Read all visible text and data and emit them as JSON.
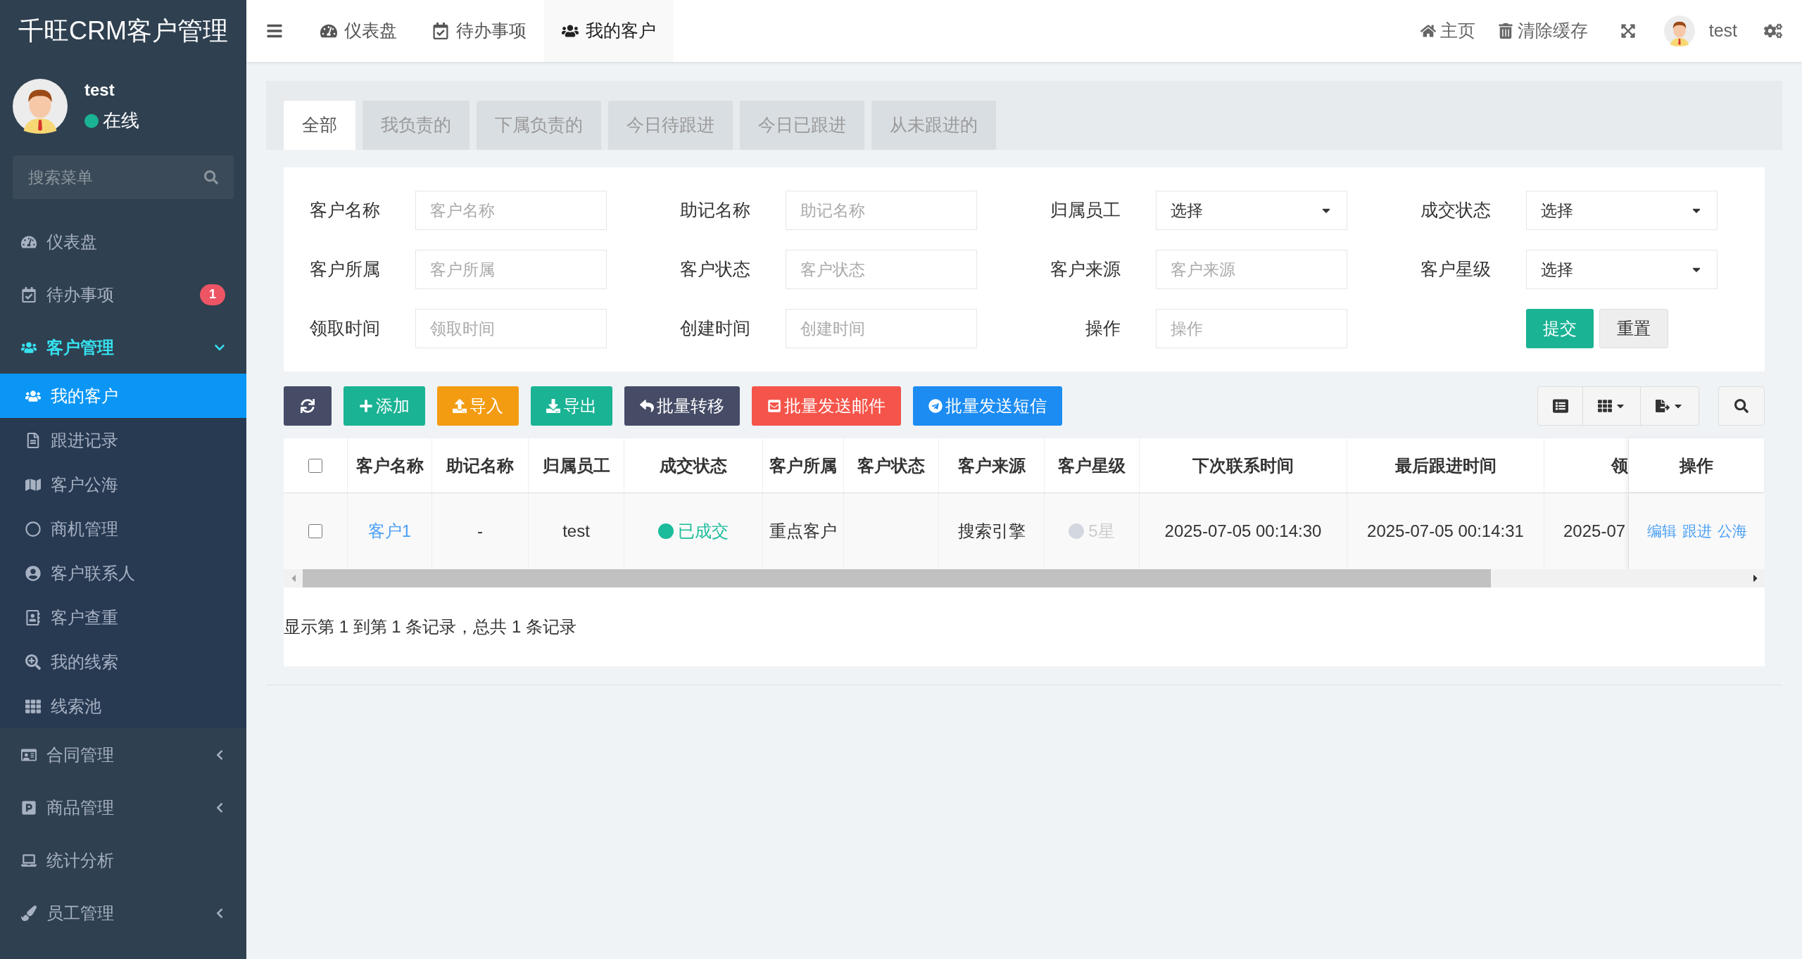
{
  "sidebar": {
    "title": "千旺CRM客户管理",
    "user": {
      "name": "test",
      "status": "在线",
      "online": true
    },
    "search": {
      "placeholder": "搜索菜单"
    },
    "items": [
      {
        "label": "仪表盘",
        "expandable": false,
        "selected": false
      },
      {
        "label": "待办事项",
        "expandable": false,
        "selected": false,
        "badge": "1"
      },
      {
        "label": "客户管理",
        "expandable": true,
        "expanded": true,
        "selected": true,
        "children": [
          {
            "label": "我的客户",
            "selected": true
          },
          {
            "label": "跟进记录",
            "selected": false
          },
          {
            "label": "客户公海",
            "selected": false
          },
          {
            "label": "商机管理",
            "selected": false
          },
          {
            "label": "客户联系人",
            "selected": false
          },
          {
            "label": "客户查重",
            "selected": false
          },
          {
            "label": "我的线索",
            "selected": false
          },
          {
            "label": "线索池",
            "selected": false
          }
        ]
      },
      {
        "label": "合同管理",
        "expandable": true,
        "expanded": false,
        "selected": false
      },
      {
        "label": "商品管理",
        "expandable": true,
        "expanded": false,
        "selected": false
      },
      {
        "label": "统计分析",
        "expandable": false,
        "selected": false
      },
      {
        "label": "员工管理",
        "expandable": true,
        "expanded": false,
        "selected": false
      }
    ]
  },
  "topbar": {
    "tabs": [
      {
        "label": "仪表盘",
        "selected": false
      },
      {
        "label": "待办事项",
        "selected": false
      },
      {
        "label": "我的客户",
        "selected": true
      }
    ],
    "actions": [
      {
        "label": "主页"
      },
      {
        "label": "清除缓存"
      }
    ],
    "user": "test"
  },
  "filter_tabs": [
    {
      "label": "全部",
      "selected": true
    },
    {
      "label": "我负责的",
      "selected": false
    },
    {
      "label": "下属负责的",
      "selected": false
    },
    {
      "label": "今日待跟进",
      "selected": false
    },
    {
      "label": "今日已跟进",
      "selected": false
    },
    {
      "label": "从未跟进的",
      "selected": false
    }
  ],
  "filters": [
    {
      "label": "客户名称",
      "kind": "input",
      "placeholder": "客户名称"
    },
    {
      "label": "助记名称",
      "kind": "input",
      "placeholder": "助记名称"
    },
    {
      "label": "归属员工",
      "kind": "select",
      "value": "选择"
    },
    {
      "label": "成交状态",
      "kind": "select",
      "value": "选择"
    },
    {
      "label": "客户所属",
      "kind": "input",
      "placeholder": "客户所属"
    },
    {
      "label": "客户状态",
      "kind": "input",
      "placeholder": "客户状态"
    },
    {
      "label": "客户来源",
      "kind": "input",
      "placeholder": "客户来源"
    },
    {
      "label": "客户星级",
      "kind": "select",
      "value": "选择"
    },
    {
      "label": "领取时间",
      "kind": "input",
      "placeholder": "领取时间"
    },
    {
      "label": "创建时间",
      "kind": "input",
      "placeholder": "创建时间"
    },
    {
      "label": "操作",
      "kind": "input",
      "placeholder": "操作"
    },
    {
      "kind": "buttons",
      "buttons": [
        "提交",
        "重置"
      ]
    }
  ],
  "toolbar": [
    {
      "color": "#464c66"
    },
    {
      "label": "添加",
      "color": "#1ab394"
    },
    {
      "label": "导入",
      "color": "#f39c12"
    },
    {
      "label": "导出",
      "color": "#1ab394"
    },
    {
      "label": "批量转移",
      "color": "#464c66"
    },
    {
      "label": "批量发送邮件",
      "color": "#f5544a"
    },
    {
      "label": "批量发送短信",
      "color": "#1c8cf2"
    }
  ],
  "table": {
    "select_all": {
      "checked": false
    },
    "columns": [
      "客户名称",
      "助记名称",
      "归属员工",
      "成交状态",
      "客户所属",
      "客户状态",
      "客户来源",
      "客户星级",
      "下次联系时间",
      "最后跟进时间",
      "领",
      "操作"
    ],
    "rows": [
      {
        "checked": false,
        "cells": [
          {
            "kind": "link",
            "text": "客户1"
          },
          {
            "kind": "plain",
            "text": "-"
          },
          {
            "kind": "plain",
            "text": "test"
          },
          {
            "kind": "dot",
            "text": "已成交",
            "color": "#1abc9c"
          },
          {
            "kind": "plain",
            "text": "重点客户"
          },
          null,
          {
            "kind": "plain",
            "text": "搜索引擎"
          },
          {
            "kind": "dot",
            "text": "5星",
            "color": "#d3d8e0"
          },
          {
            "kind": "plain",
            "text": "2025-07-05 00:14:30"
          },
          {
            "kind": "plain",
            "text": "2025-07-05 00:14:31"
          },
          {
            "kind": "plain",
            "text": "2025-07"
          }
        ],
        "actions": [
          "编辑",
          "跟进",
          "公海"
        ]
      }
    ]
  },
  "footer": "显示第 1 到第 1 条记录，总共 1 条记录"
}
